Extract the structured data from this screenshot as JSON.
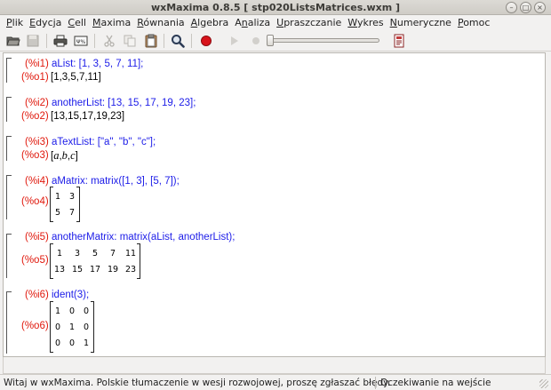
{
  "window": {
    "title": "wxMaxima 0.8.5  [ stp020ListsMatrices.wxm ]"
  },
  "menu": [
    {
      "label": "Plik",
      "key": "P",
      "rest": "lik"
    },
    {
      "label": "Edycja",
      "key": "E",
      "rest": "dycja"
    },
    {
      "label": "Cell",
      "key": "C",
      "rest": "ell"
    },
    {
      "label": "Maxima",
      "key": "M",
      "rest": "axima"
    },
    {
      "label": "Równania",
      "key": "R",
      "rest": "ównania"
    },
    {
      "label": "Algebra",
      "key": "A",
      "rest": "lgebra"
    },
    {
      "label": "Analiza",
      "key": "n",
      "pre": "A",
      "rest": "aliza"
    },
    {
      "label": "Upraszczanie",
      "key": "U",
      "rest": "praszczanie"
    },
    {
      "label": "Wykres",
      "key": "W",
      "rest": "ykres"
    },
    {
      "label": "Numeryczne",
      "key": "N",
      "rest": "umeryczne"
    },
    {
      "label": "Pomoc",
      "key": "P",
      "rest": "omoc"
    }
  ],
  "toolbar": {
    "icons": [
      "open-folder-icon",
      "save-icon",
      "print-icon",
      "config-icon",
      "cut-icon",
      "copy-icon",
      "paste-icon",
      "search-icon",
      "interrupt-icon",
      "play-icon",
      "stop-icon",
      "animation-slider",
      "help-icon"
    ]
  },
  "cells": [
    {
      "in_label": "(%i1)",
      "input": "aList: [1, 3, 5, 7, 11];",
      "out_label": "(%o1)",
      "output": "[1,3,5,7,11]"
    },
    {
      "in_label": "(%i2)",
      "input": "anotherList: [13, 15, 17, 19, 23];",
      "out_label": "(%o2)",
      "output": "[13,15,17,19,23]"
    },
    {
      "in_label": "(%i3)",
      "input": "aTextList: [\"a\", \"b\", \"c\"];",
      "out_label": "(%o3)",
      "output_parts": [
        "[",
        "a",
        ",",
        "b",
        ",",
        "c",
        "]"
      ]
    },
    {
      "in_label": "(%i4)",
      "input": "aMatrix: matrix([1, 3], [5, 7]);",
      "out_label": "(%o4)",
      "matrix": [
        [
          "1",
          "3"
        ],
        [
          "5",
          "7"
        ]
      ]
    },
    {
      "in_label": "(%i5)",
      "input": "anotherMatrix: matrix(aList, anotherList);",
      "out_label": "(%o5)",
      "matrix": [
        [
          "1",
          "3",
          "5",
          "7",
          "11"
        ],
        [
          "13",
          "15",
          "17",
          "19",
          "23"
        ]
      ]
    },
    {
      "in_label": "(%i6)",
      "input": "ident(3);",
      "out_label": "(%o6)",
      "matrix": [
        [
          "1",
          "0",
          "0"
        ],
        [
          "0",
          "1",
          "0"
        ],
        [
          "0",
          "0",
          "1"
        ]
      ]
    }
  ],
  "status": {
    "left": "Witaj w wxMaxima. Polskie tłumaczenie w wesji rozwojowej, proszę zgłaszać błędy.",
    "right": "Oczekiwanie na wejście"
  },
  "colors": {
    "label": "#e0180c",
    "input": "#1c1ce8",
    "output": "#000000"
  }
}
